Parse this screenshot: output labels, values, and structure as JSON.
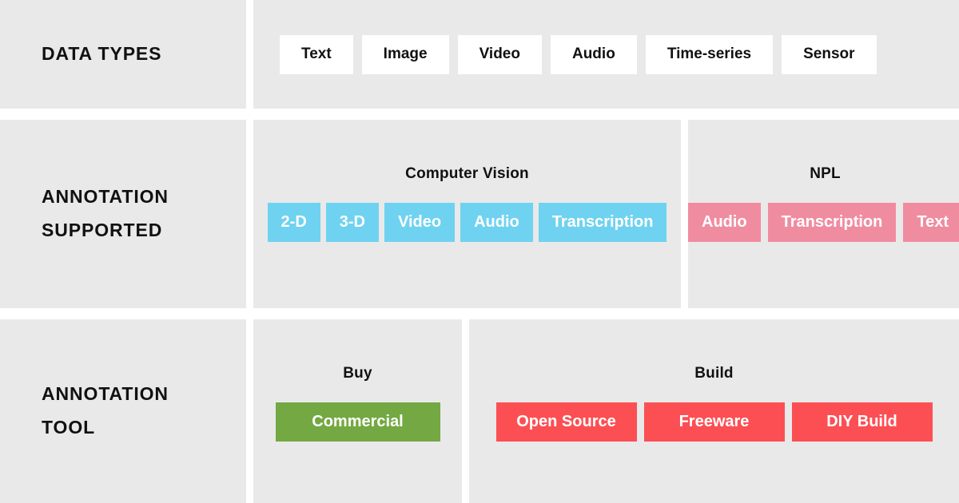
{
  "colors": {
    "panel_bg": "#e9e9e9",
    "page_bg": "#ffffff",
    "chip_white": "#ffffff",
    "chip_blue": "#6fd2f0",
    "chip_pink": "#f08ca0",
    "chip_green": "#74a842",
    "chip_red": "#fc4f53",
    "text_dark": "#111111",
    "text_light": "#ffffff"
  },
  "rows": {
    "data_types": {
      "label": "DATA TYPES",
      "chips": [
        {
          "label": "Text"
        },
        {
          "label": "Image"
        },
        {
          "label": "Video"
        },
        {
          "label": "Audio"
        },
        {
          "label": "Time-series"
        },
        {
          "label": "Sensor"
        }
      ]
    },
    "annotation_supported": {
      "label": "ANNOTATION\nSUPPORTED",
      "groups": [
        {
          "title": "Computer Vision",
          "chips": [
            {
              "label": "2-D"
            },
            {
              "label": "3-D"
            },
            {
              "label": "Video"
            },
            {
              "label": "Audio"
            },
            {
              "label": "Transcription"
            }
          ]
        },
        {
          "title": "NPL",
          "chips": [
            {
              "label": "Audio"
            },
            {
              "label": "Transcription"
            },
            {
              "label": "Text"
            }
          ]
        }
      ]
    },
    "annotation_tool": {
      "label": "ANNOTATION\nTOOL",
      "groups": [
        {
          "title": "Buy",
          "chips": [
            {
              "label": "Commercial"
            }
          ]
        },
        {
          "title": "Build",
          "chips": [
            {
              "label": "Open Source"
            },
            {
              "label": "Freeware"
            },
            {
              "label": "DIY Build"
            }
          ]
        }
      ]
    }
  }
}
